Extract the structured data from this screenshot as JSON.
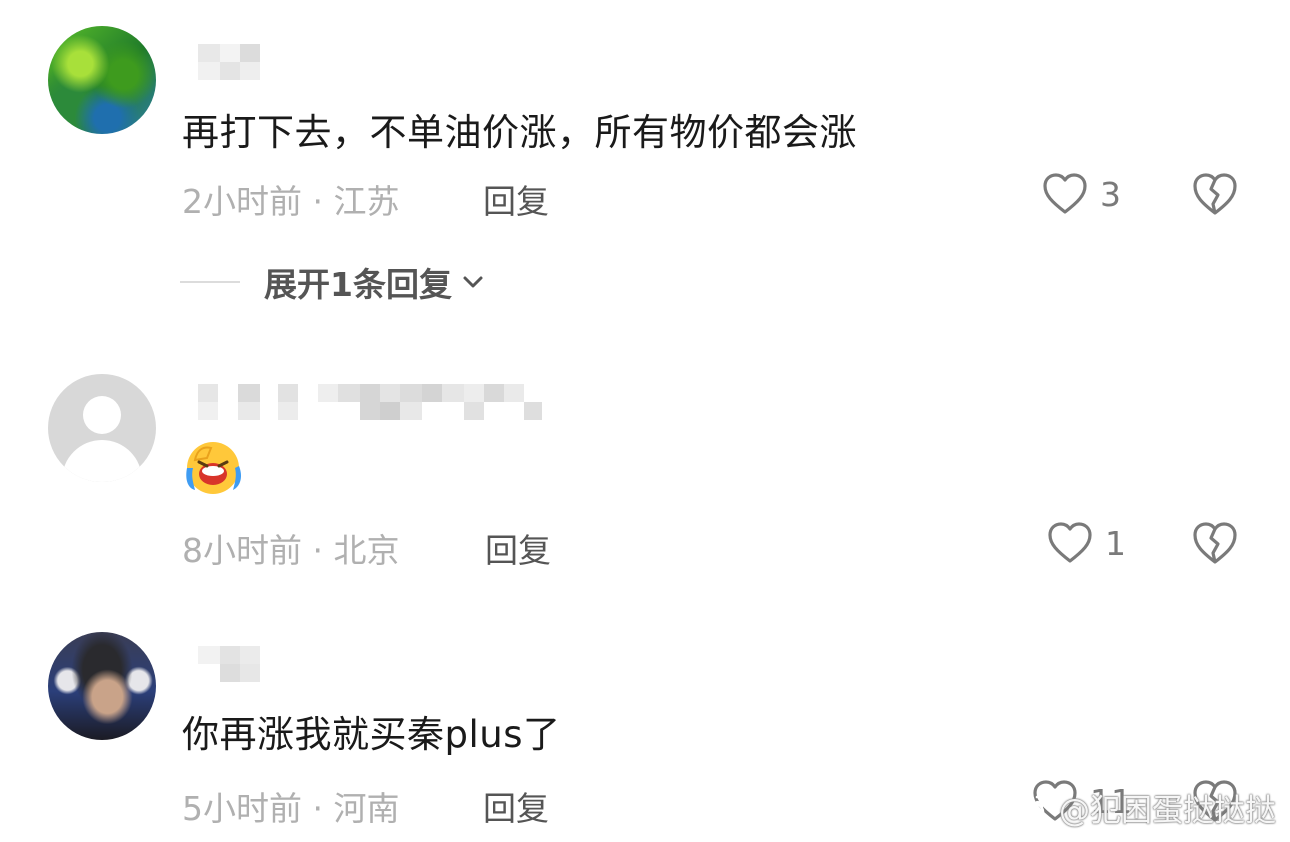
{
  "comments": [
    {
      "text": "再打下去，不单油价涨，所有物价都会涨",
      "meta": "2小时前 · 江苏",
      "reply": "回复",
      "likes": "3",
      "expand": "展开1条回复"
    },
    {
      "meta": "8小时前 · 北京",
      "reply": "回复",
      "likes": "1"
    },
    {
      "text": "你再涨我就买秦plus了",
      "meta": "5小时前 · 河南",
      "reply": "回复",
      "likes": "11"
    }
  ],
  "icons": {
    "like": "heart-outline-icon",
    "dislike": "broken-heart-icon",
    "expand": "chevron-down-icon",
    "emoji": "laughing-crying-emoji"
  },
  "watermark": "@犯困蛋挞挞挞"
}
